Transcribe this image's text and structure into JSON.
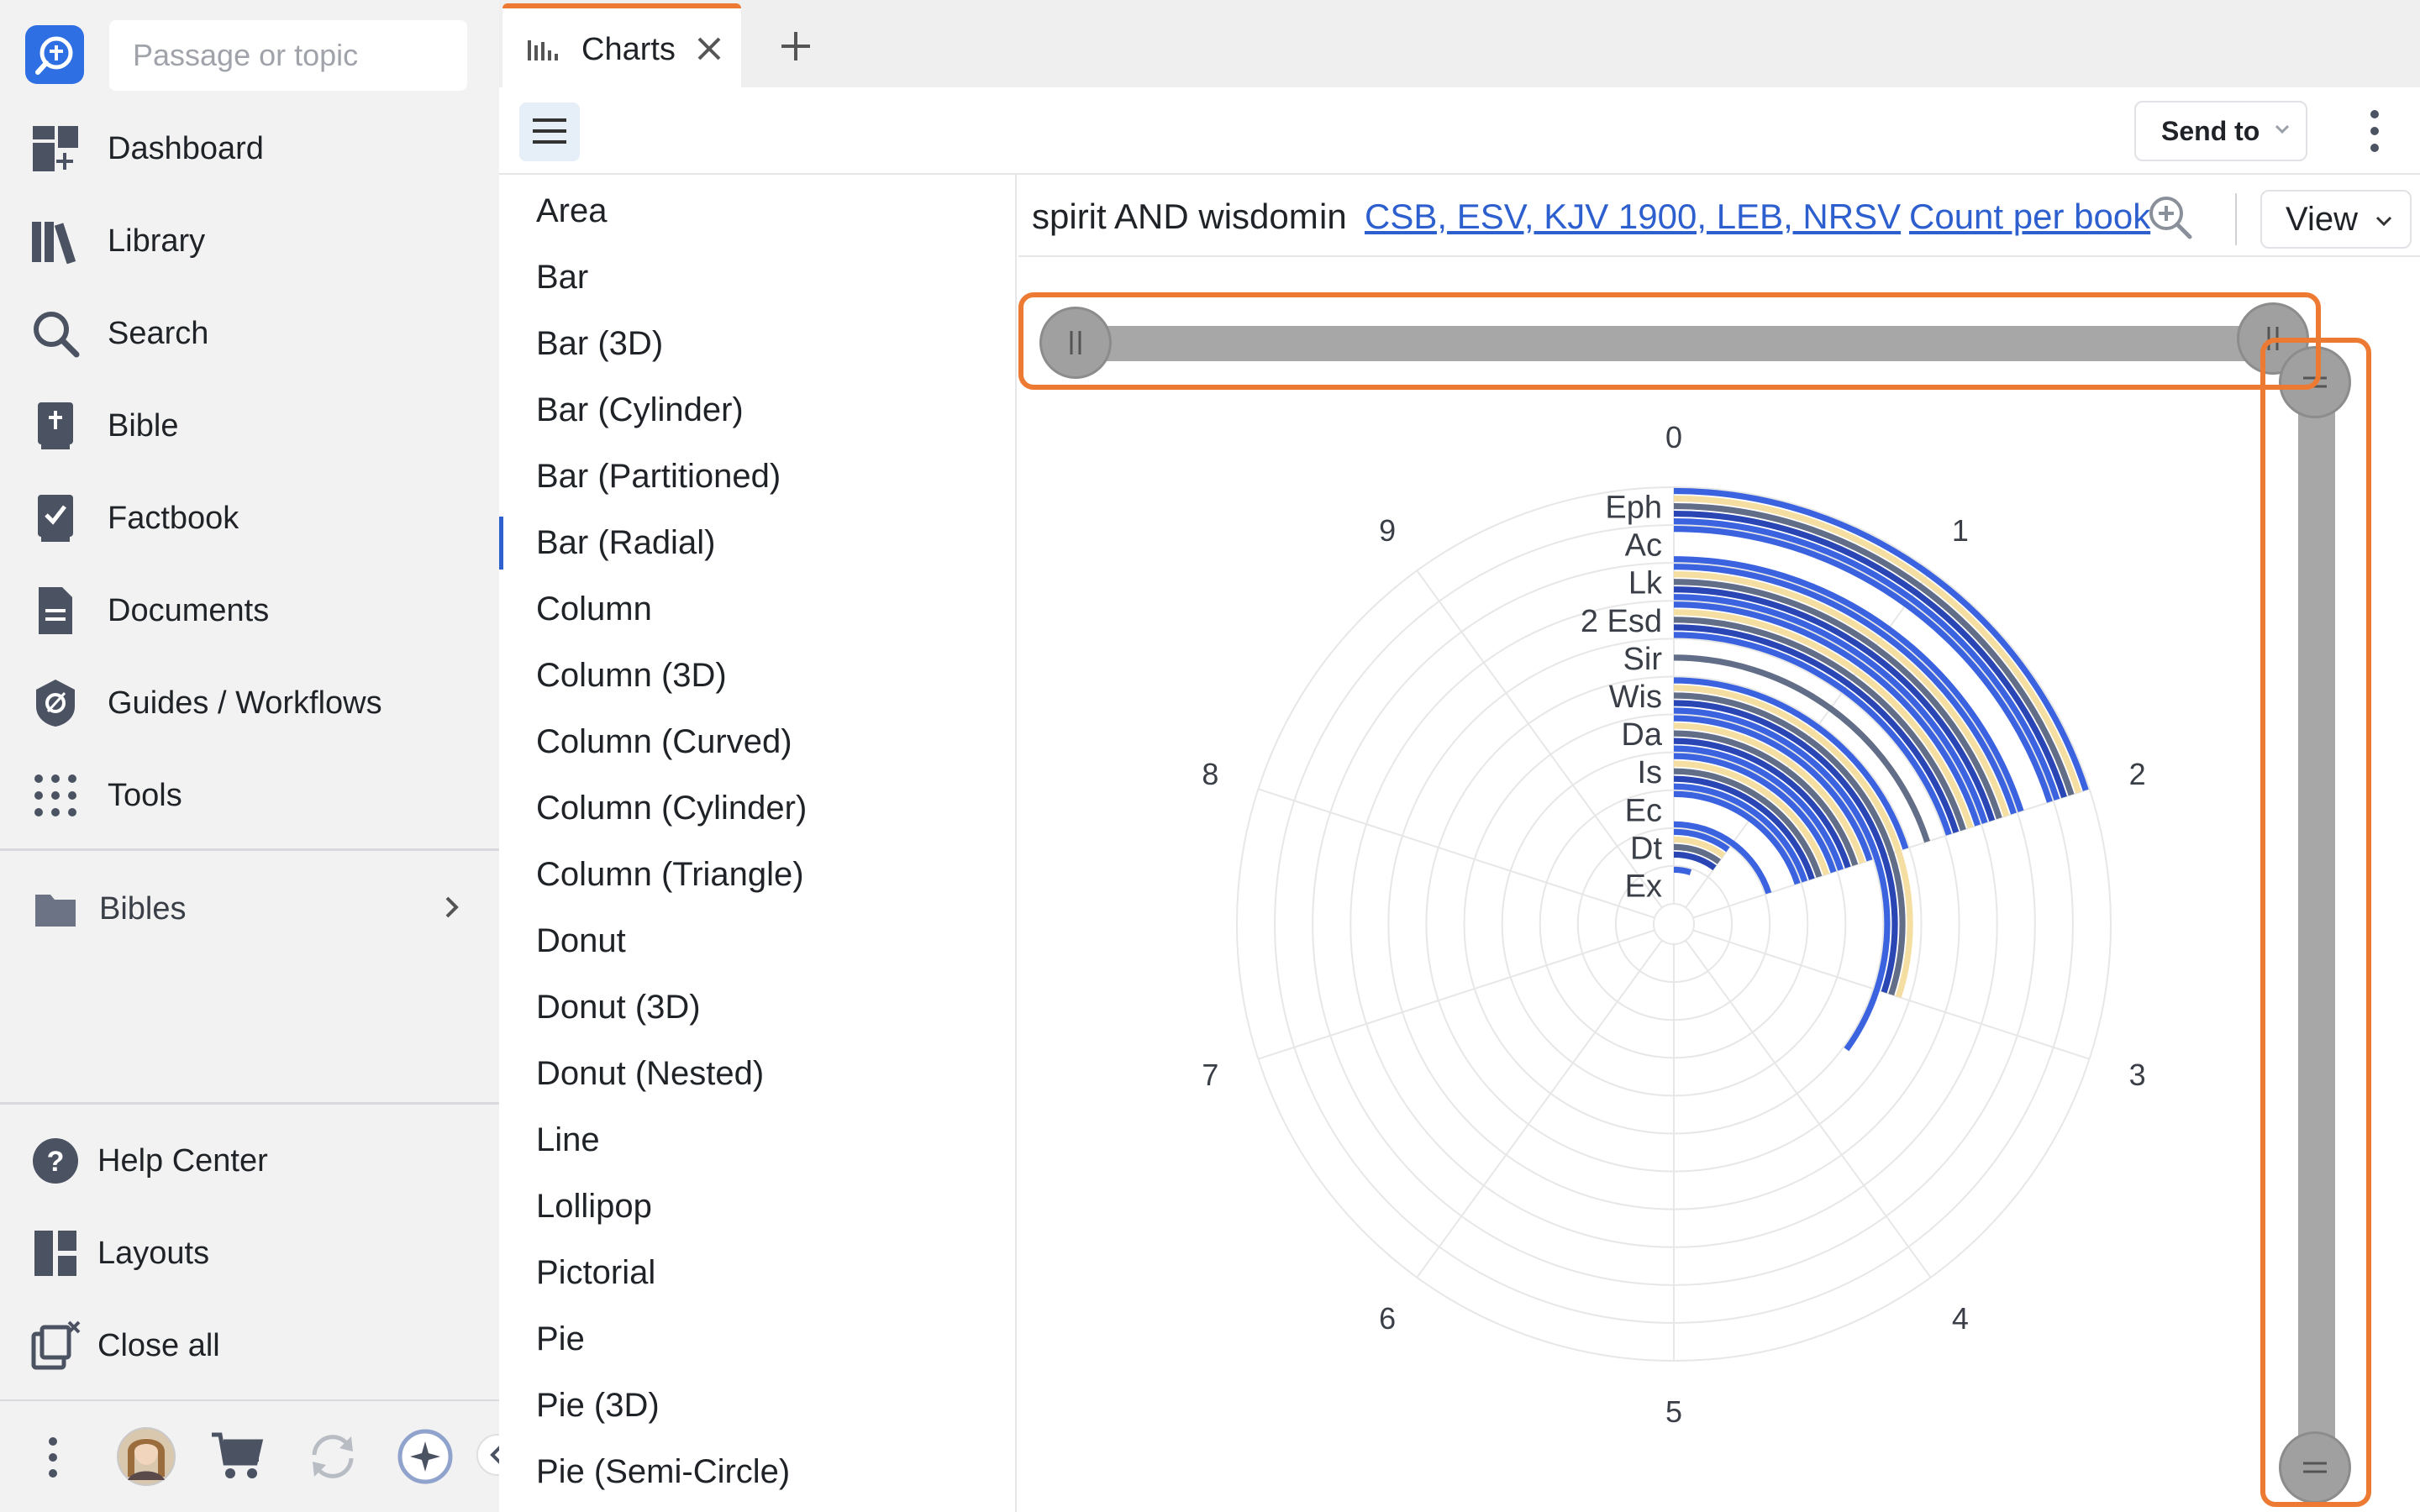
{
  "search": {
    "placeholder": "Passage or topic"
  },
  "nav": {
    "items": [
      {
        "label": "Dashboard",
        "icon": "dashboard-icon"
      },
      {
        "label": "Library",
        "icon": "library-icon"
      },
      {
        "label": "Search",
        "icon": "search-icon"
      },
      {
        "label": "Bible",
        "icon": "bible-icon"
      },
      {
        "label": "Factbook",
        "icon": "factbook-icon"
      },
      {
        "label": "Documents",
        "icon": "documents-icon"
      },
      {
        "label": "Guides / Workflows",
        "icon": "guides-icon"
      },
      {
        "label": "Tools",
        "icon": "tools-icon"
      }
    ],
    "bibles": {
      "label": "Bibles",
      "icon": "folder-icon"
    },
    "bottom": [
      {
        "label": "Help Center",
        "icon": "help-icon"
      },
      {
        "label": "Layouts",
        "icon": "layouts-icon"
      },
      {
        "label": "Close all",
        "icon": "close-all-icon"
      }
    ]
  },
  "tabs": [
    {
      "label": "Charts",
      "icon": "chart-icon",
      "active": true
    }
  ],
  "toolbar": {
    "send_to": "Send to"
  },
  "chart_types": {
    "selected": "Bar (Radial)",
    "items": [
      "Area",
      "Bar",
      "Bar (3D)",
      "Bar (Cylinder)",
      "Bar (Partitioned)",
      "Bar (Radial)",
      "Column",
      "Column (3D)",
      "Column (Curved)",
      "Column (Cylinder)",
      "Column (Triangle)",
      "Donut",
      "Donut (3D)",
      "Donut (Nested)",
      "Line",
      "Lollipop",
      "Pictorial",
      "Pie",
      "Pie (3D)",
      "Pie (Semi-Circle)"
    ]
  },
  "query": {
    "terms": "spirit AND wisdom",
    "in_label": "in",
    "bibles": "CSB, ESV, KJV 1900, LEB, NRSV",
    "mode": "Count per book"
  },
  "view_button": "View",
  "colors": {
    "accent": "#ed7a33",
    "link": "#2d5fcf",
    "series": [
      "#3b63e0",
      "#f5dea2",
      "#626d87",
      "#2a46b5",
      "#3b63e0"
    ]
  },
  "chart_data": {
    "type": "bar",
    "orientation": "radial",
    "categories": [
      "Eph",
      "Ac",
      "Lk",
      "2 Esd",
      "Sir",
      "Wis",
      "Da",
      "Is",
      "Ec",
      "Dt",
      "Ex"
    ],
    "angular_ticks": [
      "0",
      "1",
      "2",
      "3",
      "4",
      "5",
      "6",
      "7",
      "8",
      "9"
    ],
    "angular_range": [
      0,
      10
    ],
    "series": [
      {
        "values": [
          2,
          2,
          2,
          2,
          0,
          2,
          2,
          2,
          2,
          1,
          0.5
        ]
      },
      {
        "values": [
          2,
          0,
          2,
          2,
          0,
          3,
          2,
          2,
          0,
          1,
          0
        ]
      },
      {
        "values": [
          2,
          0,
          2,
          2,
          2,
          3,
          2,
          2,
          0,
          1,
          0
        ]
      },
      {
        "values": [
          2,
          0,
          2,
          2,
          0,
          3,
          2,
          2,
          0,
          1,
          0
        ]
      },
      {
        "values": [
          2,
          2,
          2,
          2,
          0,
          3.5,
          2,
          2,
          2,
          0,
          0
        ]
      }
    ],
    "grid": true,
    "legend": "none"
  }
}
